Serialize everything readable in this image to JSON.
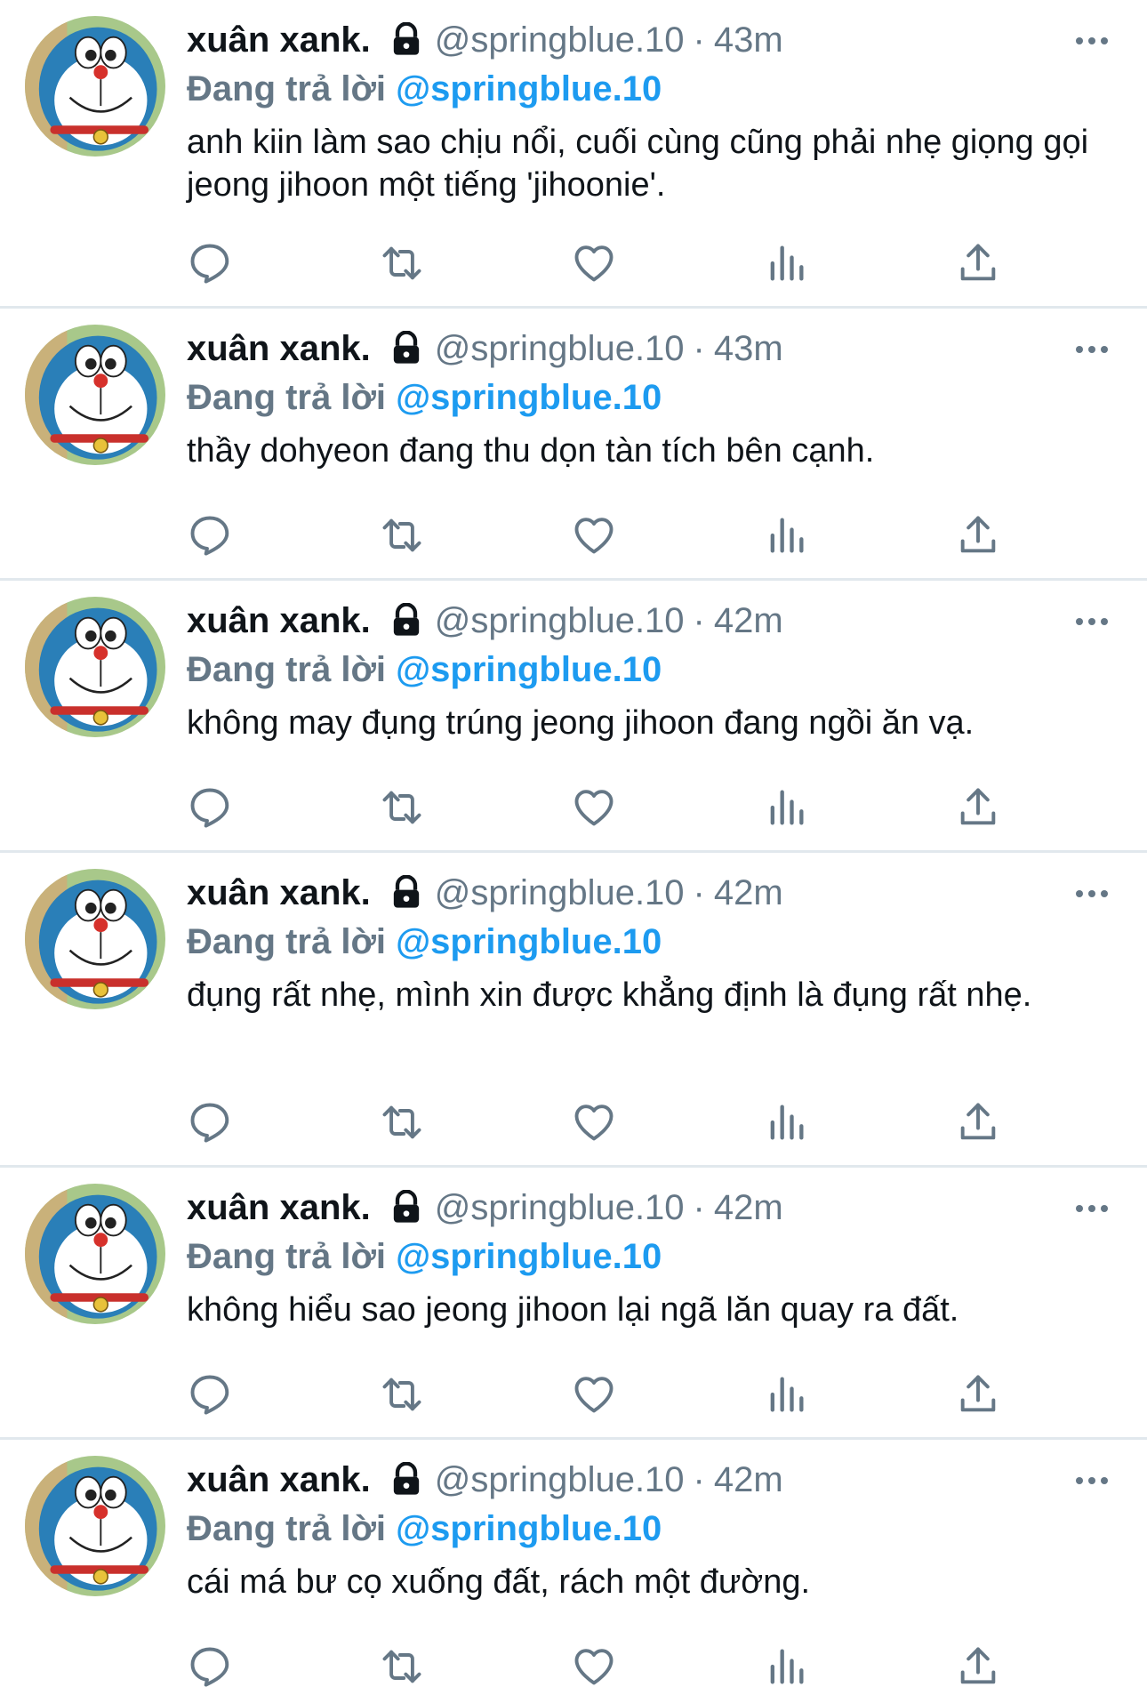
{
  "tweets": [
    {
      "name": "xuân xank.",
      "handle": "@springblue.10",
      "separator": "·",
      "time": "43m",
      "reply_prefix": "Đang trả lời",
      "reply_handle": "@springblue.10",
      "text": "anh kiin làm sao chịu nổi, cuối cùng cũng phải nhẹ giọng gọi jeong jihoon một tiếng 'jihoonie'."
    },
    {
      "name": "xuân xank.",
      "handle": "@springblue.10",
      "separator": "·",
      "time": "43m",
      "reply_prefix": "Đang trả lời",
      "reply_handle": "@springblue.10",
      "text": "thầy dohyeon đang thu dọn tàn tích bên cạnh."
    },
    {
      "name": "xuân xank.",
      "handle": "@springblue.10",
      "separator": "·",
      "time": "42m",
      "reply_prefix": "Đang trả lời",
      "reply_handle": "@springblue.10",
      "text": "không may đụng trúng jeong jihoon đang ngồi ăn vạ."
    },
    {
      "name": "xuân xank.",
      "handle": "@springblue.10",
      "separator": "·",
      "time": "42m",
      "reply_prefix": "Đang trả lời",
      "reply_handle": "@springblue.10",
      "text": "đụng rất nhẹ, mình xin được khẳng định là đụng rất nhẹ."
    },
    {
      "name": "xuân xank.",
      "handle": "@springblue.10",
      "separator": "·",
      "time": "42m",
      "reply_prefix": "Đang trả lời",
      "reply_handle": "@springblue.10",
      "text": "không hiểu sao jeong jihoon lại ngã lăn quay ra đất."
    },
    {
      "name": "xuân xank.",
      "handle": "@springblue.10",
      "separator": "·",
      "time": "42m",
      "reply_prefix": "Đang trả lời",
      "reply_handle": "@springblue.10",
      "text": "cái má bư cọ xuống đất, rách một đường."
    }
  ],
  "icons": {
    "avatar": "doraemon-avatar",
    "lock": "lock-icon",
    "more": "more-options-icon",
    "reply": "reply-icon",
    "retweet": "retweet-icon",
    "like": "heart-icon",
    "views": "views-icon",
    "share": "share-icon"
  },
  "colors": {
    "link": "#1d9bf0",
    "secondary": "#657786",
    "text": "#0f1419",
    "divider": "#e1e8ed"
  }
}
